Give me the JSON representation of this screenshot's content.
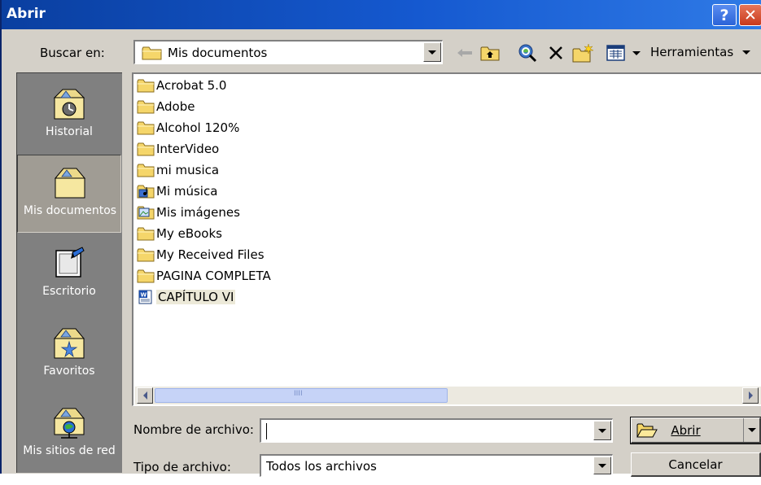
{
  "window": {
    "title": "Abrir",
    "help_glyph": "?",
    "close_glyph": "✕"
  },
  "toolbar": {
    "look_in_label": "Buscar en:",
    "look_in_value": "Mis documentos",
    "tools_label": "Herramientas"
  },
  "places": [
    {
      "label": "Historial",
      "icon": "history-icon"
    },
    {
      "label": "Mis documentos",
      "icon": "my-documents-icon",
      "selected": true
    },
    {
      "label": "Escritorio",
      "icon": "desktop-icon"
    },
    {
      "label": "Favoritos",
      "icon": "favorites-icon"
    },
    {
      "label": "Mis sitios de red",
      "icon": "network-places-icon"
    }
  ],
  "files": [
    {
      "name": "Acrobat 5.0",
      "icon": "folder-icon"
    },
    {
      "name": "Adobe",
      "icon": "folder-icon"
    },
    {
      "name": "Alcohol 120%",
      "icon": "folder-icon"
    },
    {
      "name": "InterVideo",
      "icon": "folder-icon"
    },
    {
      "name": "mi musica",
      "icon": "folder-icon"
    },
    {
      "name": "Mi música",
      "icon": "music-folder-icon"
    },
    {
      "name": "Mis imágenes",
      "icon": "pictures-folder-icon"
    },
    {
      "name": "My eBooks",
      "icon": "folder-icon"
    },
    {
      "name": "My Received Files",
      "icon": "folder-icon"
    },
    {
      "name": "PAGINA COMPLETA",
      "icon": "folder-icon"
    },
    {
      "name": "CAPÍTULO VI",
      "icon": "word-document-icon",
      "selected": true
    }
  ],
  "scrollbar": {
    "thumb_glyph": "IIII"
  },
  "form": {
    "filename_label": "Nombre de archivo:",
    "filename_value": "",
    "filetype_label": "Tipo de archivo:",
    "filetype_value": "Todos los archivos"
  },
  "buttons": {
    "open_label": "Abrir",
    "cancel_label": "Cancelar"
  },
  "colors": {
    "title_bar": "#0a3fa0",
    "dialog_face": "#d4d0c8",
    "places_bar": "#808080",
    "folder_yellow": "#f5d66a"
  }
}
